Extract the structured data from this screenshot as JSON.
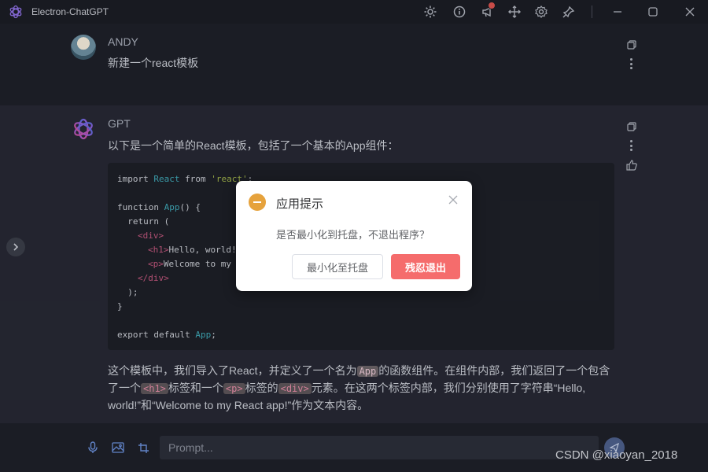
{
  "window": {
    "title": "Electron-ChatGPT"
  },
  "titlebar": {
    "icons": [
      "sun-icon",
      "info-icon",
      "megaphone-icon",
      "move-icon",
      "settings-icon",
      "pin-icon",
      "minimize-icon",
      "maximize-icon",
      "close-icon"
    ]
  },
  "user_message": {
    "name": "ANDY",
    "text": "新建一个react模板"
  },
  "gpt_message": {
    "name": "GPT",
    "intro": "以下是一个简单的React模板，包括了一个基本的App组件：",
    "code": {
      "l1a": "import ",
      "l1b": "React",
      "l1c": " from ",
      "l1d": "'react'",
      "l1e": ";",
      "l3a": "function ",
      "l3b": "App",
      "l3c": "() {",
      "l4": "  return (",
      "l5": "<div>",
      "l6a": "<h1>",
      "l6b": "Hello, world!",
      "l7a": "<p>",
      "l7b": "Welcome to my",
      "l8": "</div>",
      "l9": "  );",
      "l10": "}",
      "l12a": "export default ",
      "l12b": "App",
      "l12c": ";"
    },
    "explain": {
      "p1a": "这个模板中，我们导入了React，并定义了一个名为",
      "c1": "App",
      "p1b": "的函数组件。在组件内部，我们返回了一个包含",
      "p2a": "了一个",
      "c2": "<h1>",
      "p2b": "标签和一个",
      "c3": "<p>",
      "p2c": "标签的",
      "c4": "<div>",
      "p2d": "元素。在这两个标签内部，我们分别使用了字符串“Hello,",
      "p3": "world!”和“Welcome to my React app!”作为文本内容。"
    }
  },
  "input": {
    "placeholder": "Prompt..."
  },
  "watermark": "CSDN @xiaoyan_2018",
  "dialog": {
    "title": "应用提示",
    "message": "是否最小化到托盘，不退出程序？",
    "cancel_label": "最小化至托盘",
    "confirm_label": "残忍退出",
    "icon": "warning-icon"
  },
  "colors": {
    "accent": "#f56c6c",
    "warning": "#e6a23c",
    "background": "#21242e"
  }
}
